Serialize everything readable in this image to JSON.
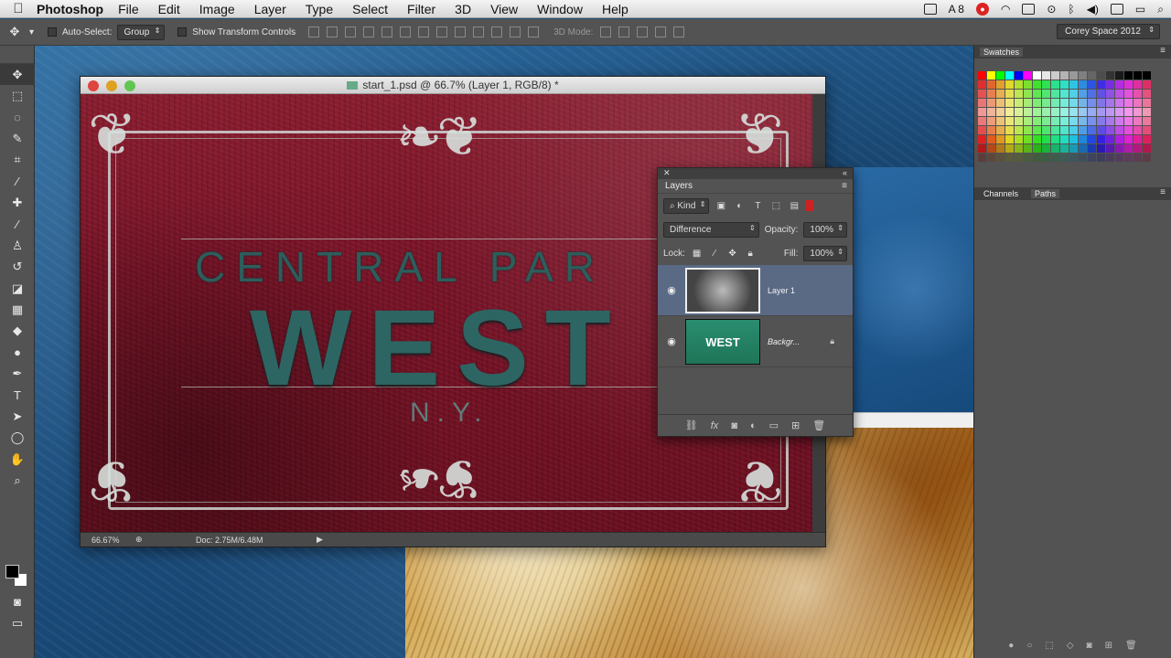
{
  "menubar": {
    "app": "Photoshop",
    "items": [
      "File",
      "Edit",
      "Image",
      "Layer",
      "Type",
      "Select",
      "Filter",
      "3D",
      "View",
      "Window",
      "Help"
    ],
    "tray_badge": "8"
  },
  "options": {
    "auto_select": "Auto-Select:",
    "auto_select_value": "Group",
    "show_transform": "Show Transform Controls",
    "mode3d": "3D Mode:",
    "workspace": "Corey Space 2012"
  },
  "document": {
    "title": "start_1.psd @ 66.7% (Layer 1, RGB/8) *",
    "zoom": "66.67%",
    "doc_size": "Doc: 2.75M/6.48M",
    "sign": {
      "line1": "CENTRAL PAR",
      "line2": "WEST",
      "line3": "N.Y."
    }
  },
  "layers_panel": {
    "title": "Layers",
    "filter_kind": "Kind",
    "blend_mode": "Difference",
    "opacity_label": "Opacity:",
    "opacity_value": "100%",
    "lock_label": "Lock:",
    "fill_label": "Fill:",
    "fill_value": "100%",
    "layers": [
      {
        "name": "Layer 1",
        "active": true
      },
      {
        "name": "Backgr...",
        "thumb_text": "WEST",
        "locked": true
      }
    ]
  },
  "right_panels": {
    "swatches_tab": "Swatches",
    "channels_tab": "Channels",
    "paths_tab": "Paths"
  },
  "colors": {
    "accent_selected_layer": "#5a6a85",
    "canvas_red": "#7a1428",
    "sign_teal": "#2d6563"
  }
}
